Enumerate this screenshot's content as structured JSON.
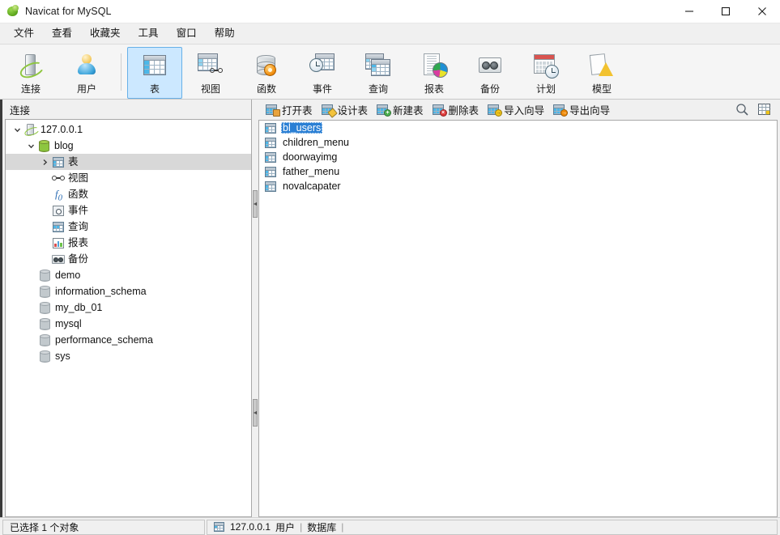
{
  "window": {
    "title": "Navicat for MySQL",
    "logo_icon": "navicat-leaf-logo",
    "controls": {
      "minimize": "minimize-icon",
      "maximize": "maximize-icon",
      "close": "close-icon"
    }
  },
  "menubar": {
    "items": [
      {
        "label": "文件"
      },
      {
        "label": "查看"
      },
      {
        "label": "收藏夹"
      },
      {
        "label": "工具"
      },
      {
        "label": "窗口"
      },
      {
        "label": "帮助"
      }
    ]
  },
  "toolbar": {
    "groups": [
      {
        "buttons": [
          {
            "label": "连接",
            "icon": "connection-icon",
            "selected": false
          },
          {
            "label": "用户",
            "icon": "user-icon",
            "selected": false
          }
        ]
      },
      {
        "buttons": [
          {
            "label": "表",
            "icon": "table-icon",
            "selected": true
          },
          {
            "label": "视图",
            "icon": "view-icon",
            "selected": false
          },
          {
            "label": "函数",
            "icon": "function-icon",
            "selected": false
          },
          {
            "label": "事件",
            "icon": "event-icon",
            "selected": false
          },
          {
            "label": "查询",
            "icon": "query-icon",
            "selected": false
          },
          {
            "label": "报表",
            "icon": "report-icon",
            "selected": false
          },
          {
            "label": "备份",
            "icon": "backup-icon",
            "selected": false
          },
          {
            "label": "计划",
            "icon": "schedule-icon",
            "selected": false
          },
          {
            "label": "模型",
            "icon": "model-icon",
            "selected": false
          }
        ]
      }
    ]
  },
  "left_pane": {
    "header": "连接",
    "tree": [
      {
        "label": "127.0.0.1",
        "icon": "host-icon",
        "depth": 0,
        "twist": "expanded",
        "selected": false
      },
      {
        "label": "blog",
        "icon": "database-active-icon",
        "depth": 1,
        "twist": "expanded",
        "selected": false
      },
      {
        "label": "表",
        "icon": "table-folder-icon",
        "depth": 2,
        "twist": "collapsed",
        "selected": true
      },
      {
        "label": "视图",
        "icon": "view-folder-icon",
        "depth": 2,
        "twist": "none",
        "selected": false
      },
      {
        "label": "函数",
        "icon": "function-folder-icon",
        "depth": 2,
        "twist": "none",
        "selected": false
      },
      {
        "label": "事件",
        "icon": "event-folder-icon",
        "depth": 2,
        "twist": "none",
        "selected": false
      },
      {
        "label": "查询",
        "icon": "query-folder-icon",
        "depth": 2,
        "twist": "none",
        "selected": false
      },
      {
        "label": "报表",
        "icon": "report-folder-icon",
        "depth": 2,
        "twist": "none",
        "selected": false
      },
      {
        "label": "备份",
        "icon": "backup-folder-icon",
        "depth": 2,
        "twist": "none",
        "selected": false
      },
      {
        "label": "demo",
        "icon": "database-icon",
        "depth": 1,
        "twist": "none",
        "selected": false
      },
      {
        "label": "information_schema",
        "icon": "database-icon",
        "depth": 1,
        "twist": "none",
        "selected": false
      },
      {
        "label": "my_db_01",
        "icon": "database-icon",
        "depth": 1,
        "twist": "none",
        "selected": false
      },
      {
        "label": "mysql",
        "icon": "database-icon",
        "depth": 1,
        "twist": "none",
        "selected": false
      },
      {
        "label": "performance_schema",
        "icon": "database-icon",
        "depth": 1,
        "twist": "none",
        "selected": false
      },
      {
        "label": "sys",
        "icon": "database-icon",
        "depth": 1,
        "twist": "none",
        "selected": false
      }
    ]
  },
  "action_bar": {
    "actions": [
      {
        "label": "打开表",
        "icon": "open-table-icon",
        "badge": "folder"
      },
      {
        "label": "设计表",
        "icon": "design-table-icon",
        "badge": "pencil"
      },
      {
        "label": "新建表",
        "icon": "new-table-icon",
        "badge": "green"
      },
      {
        "label": "删除表",
        "icon": "delete-table-icon",
        "badge": "red"
      },
      {
        "label": "导入向导",
        "icon": "import-wizard-icon",
        "badge": "yellow"
      },
      {
        "label": "导出向导",
        "icon": "export-wizard-icon",
        "badge": "orange"
      }
    ],
    "right_icons": [
      {
        "icon": "search-icon"
      },
      {
        "icon": "grid-view-icon"
      }
    ]
  },
  "table_list": {
    "items": [
      {
        "label": "bl_users",
        "icon": "table-icon",
        "selected": true
      },
      {
        "label": "children_menu",
        "icon": "table-icon",
        "selected": false
      },
      {
        "label": "doorwayimg",
        "icon": "table-icon",
        "selected": false
      },
      {
        "label": "father_menu",
        "icon": "table-icon",
        "selected": false
      },
      {
        "label": "novalcapater",
        "icon": "table-icon",
        "selected": false
      }
    ]
  },
  "statusbar": {
    "selection_text": "已选择 1 个对象",
    "connection_icon": "server-icon",
    "host": "127.0.0.1",
    "user_label": "用户",
    "separator": "|",
    "database_label": "数据库",
    "database_value": "|"
  },
  "colors": {
    "accent": "#2a7fd4",
    "selected_toolbar_fill": "#cce8ff",
    "selected_toolbar_border": "#67b0e8",
    "tree_selection": "#d8d8d8",
    "chrome": "#f0f0f0"
  }
}
